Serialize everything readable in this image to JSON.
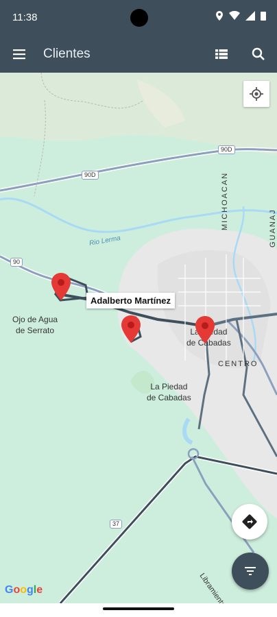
{
  "status_bar": {
    "time": "11:38"
  },
  "app_bar": {
    "title": "Clientes"
  },
  "map": {
    "labels": {
      "town1_line1": "Ojo de Agua",
      "town1_line2": "de Serrato",
      "city_line1": "La Piedad",
      "city_line2": "de Cabadas",
      "city_center_line1": "La Piedad",
      "city_center_line2": "de Cabadas",
      "centro": "CENTRO",
      "michoacan": "MICHOACAN",
      "guanajuato": "GUANAJ",
      "river": "Rio Lerma",
      "road_900": "90D",
      "road_90": "90",
      "road_37": "37",
      "libramiento": "Libramiento de"
    },
    "callout": "Adalberto Martínez",
    "attribution": "Google",
    "colors": {
      "marker": "#e53935",
      "route": "#3e4f5b",
      "land": "#cdeedd"
    }
  }
}
